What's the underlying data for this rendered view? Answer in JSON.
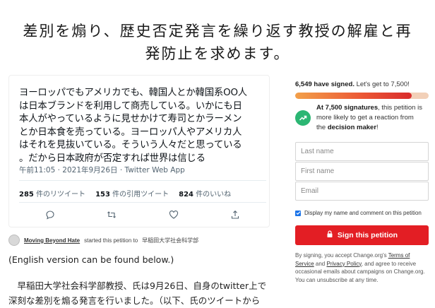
{
  "petition": {
    "title_line1": "差別を煽り、歴史否定発言を繰り返す教授の解雇と再",
    "title_line2": "発防止を求めます。"
  },
  "tweet": {
    "lines": [
      "ヨーロッパでもアメリカでも、韓国人とか韓国系OO人",
      "は日本ブランドを利用して商売している。いかにも日",
      "本人がやっているように見せかけて寿司とかラーメン",
      "とか日本食を売っている。ヨーロッパ人やアメリカ人",
      "はそれを見抜いている。そういう人々だと思っている",
      "。だから日本政府が否定すれば世界は信じる"
    ],
    "meta": "午前11:05 · 2021年9月26日 · Twitter Web App",
    "retweets_count": "285",
    "retweets_label": "件のリツイート",
    "quotes_count": "153",
    "quotes_label": "件の引用ツイート",
    "likes_count": "824",
    "likes_label": "件のいいね"
  },
  "starter": {
    "name": "Moving Beyond Hate",
    "action": "started this petition to",
    "target": "早稲田大学社会科学部"
  },
  "body": {
    "line1": "(English version can be found below.)",
    "line2": "　早稲田大学社会科学部教授、氏は9月26日、自身のtwitter上で",
    "line3": "深刻な差別を煽る発言を行いました。（以下、氏のツイートから"
  },
  "sidebar": {
    "signed_count": "6,549 have signed.",
    "signed_goal": "Let's get to 7,500!",
    "progress_fraction": 0.873,
    "goal_bold": "At 7,500 signatures",
    "goal_text_1": ", this petition is",
    "goal_text_2": "more likely to get a reaction from",
    "goal_text_3": "the ",
    "goal_target": "decision maker",
    "goal_end": "!",
    "first_name_placeholder": "First name",
    "last_name_placeholder": "Last name",
    "email_placeholder": "Email",
    "display_checkbox_label": "Display my name and comment on this petition",
    "sign_button": "Sign this petition",
    "legal_1a": "By signing, you accept Change.org's ",
    "legal_1b": "Terms of",
    "legal_2a": "Service",
    "legal_2b": " and ",
    "legal_2c": "Privacy Policy",
    "legal_2d": ", and agree to receive",
    "legal_3": "occasional emails about campaigns on Change.org.",
    "legal_4": "You can unsubscribe at any time."
  },
  "colors": {
    "sign_button": "#e31e24",
    "goal_icon": "#2bb673",
    "checkbox": "#1a73e8"
  }
}
